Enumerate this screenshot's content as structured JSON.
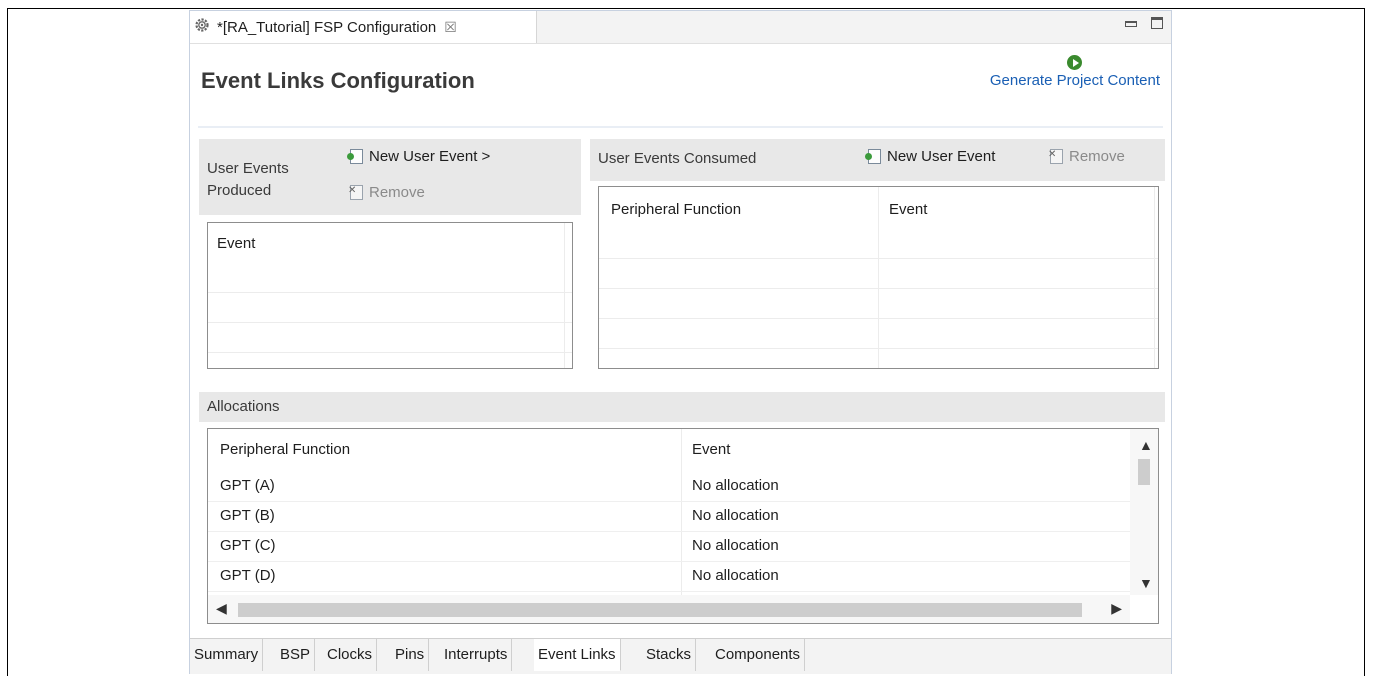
{
  "editor": {
    "tab_title": "*[RA_Tutorial] FSP Configuration",
    "close_glyph": "☒",
    "page_title": "Event Links Configuration",
    "generate_label": "Generate Project Content"
  },
  "produced": {
    "header_line1": "User Events",
    "header_line2": "Produced",
    "new_label": "New User Event >",
    "remove_label": "Remove",
    "column": "Event"
  },
  "consumed": {
    "header": "User Events Consumed",
    "new_label": "New User Event",
    "remove_label": "Remove",
    "columns": [
      "Peripheral Function",
      "Event"
    ]
  },
  "allocations": {
    "header": "Allocations",
    "columns": [
      "Peripheral Function",
      "Event"
    ],
    "rows": [
      {
        "function": "GPT (A)",
        "event": "No allocation"
      },
      {
        "function": "GPT (B)",
        "event": "No allocation"
      },
      {
        "function": "GPT (C)",
        "event": "No allocation"
      },
      {
        "function": "GPT (D)",
        "event": "No allocation"
      }
    ]
  },
  "bottom_tabs": [
    "Summary",
    "BSP",
    "Clocks",
    "Pins",
    "Interrupts",
    "Event Links",
    "Stacks",
    "Components"
  ],
  "active_tab": "Event Links"
}
